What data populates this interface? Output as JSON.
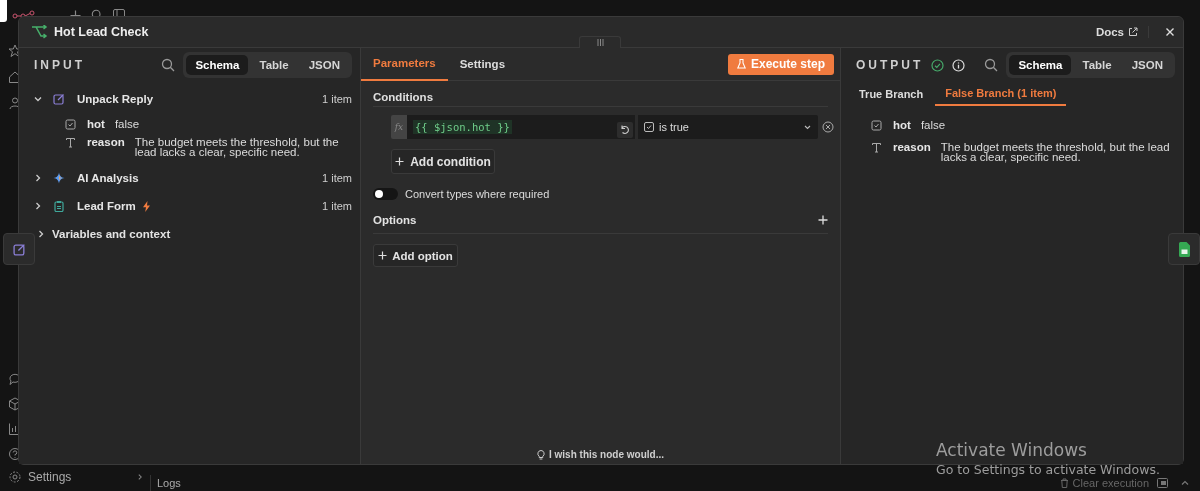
{
  "app": {
    "settings": "Settings",
    "logs": "Logs",
    "clear_execution": "Clear execution"
  },
  "modal": {
    "title": "Hot Lead Check",
    "docs": "Docs"
  },
  "input": {
    "heading": "INPUT",
    "view_tabs": [
      {
        "label": "Schema",
        "selected": true
      },
      {
        "label": "Table",
        "selected": false
      },
      {
        "label": "JSON",
        "selected": false
      }
    ],
    "nodes": [
      {
        "name": "Unpack Reply",
        "kind": "code",
        "count": "1 item",
        "expanded": true,
        "trigger": false,
        "fields": [
          {
            "kind": "boolean",
            "key": "hot",
            "value": "false"
          },
          {
            "kind": "string",
            "key": "reason",
            "value": "The budget meets the threshold, but the lead lacks a clear, specific need."
          }
        ]
      },
      {
        "name": "AI Analysis",
        "kind": "ai",
        "count": "1 item",
        "expanded": false,
        "trigger": false
      },
      {
        "name": "Lead Form",
        "kind": "form",
        "count": "1 item",
        "expanded": false,
        "trigger": true
      }
    ],
    "variables": "Variables and context"
  },
  "parameters": {
    "tabs": [
      {
        "label": "Parameters",
        "selected": true
      },
      {
        "label": "Settings",
        "selected": false
      }
    ],
    "execute": "Execute step",
    "conditions_label": "Conditions",
    "condition": {
      "prefix": "fx",
      "expression": "{{ $json.hot }}",
      "operator": "is true"
    },
    "add_condition": "Add condition",
    "toggle": {
      "label": "Convert types where required",
      "on": false
    },
    "options_label": "Options",
    "add_option": "Add option",
    "feedback": "I wish this node would..."
  },
  "output": {
    "heading": "OUTPUT",
    "view_tabs": [
      {
        "label": "Schema",
        "selected": true
      },
      {
        "label": "Table",
        "selected": false
      },
      {
        "label": "JSON",
        "selected": false
      }
    ],
    "branch_tabs": [
      {
        "label": "True Branch",
        "selected": false
      },
      {
        "label": "False Branch (1 item)",
        "selected": true
      }
    ],
    "fields": [
      {
        "kind": "boolean",
        "key": "hot",
        "value": "false"
      },
      {
        "kind": "string",
        "key": "reason",
        "value": "The budget meets the threshold, but the lead lacks a clear, specific need."
      }
    ]
  },
  "os_notice": {
    "title": "Activate Windows",
    "text": "Go to Settings to activate Windows."
  }
}
